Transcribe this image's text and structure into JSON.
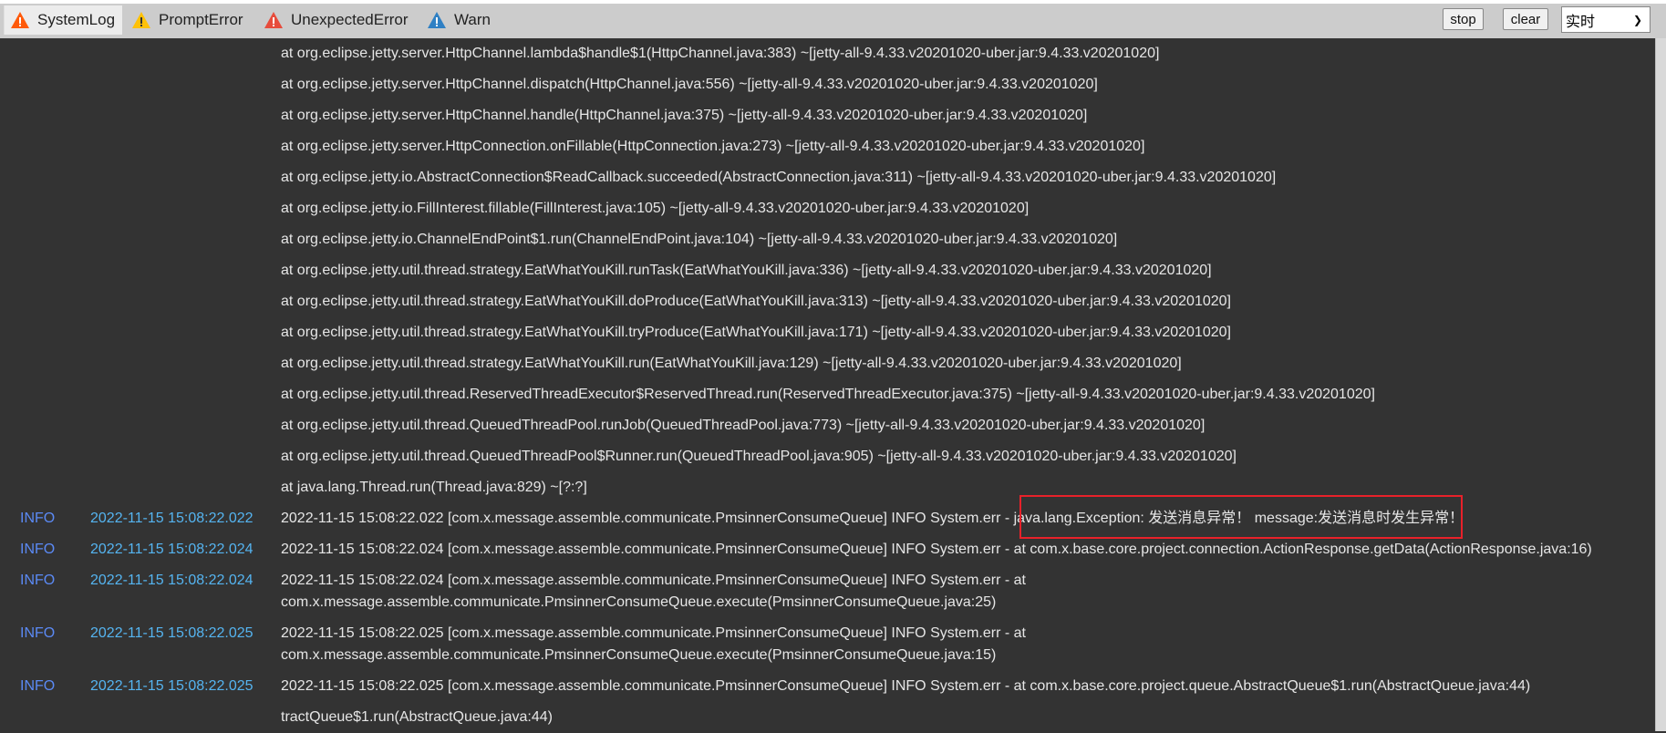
{
  "tabs": [
    {
      "label": "SystemLog",
      "icon": "warning-orange-icon",
      "color": "#ff5a0a",
      "active": true
    },
    {
      "label": "PromptError",
      "icon": "warning-yellow-icon",
      "color": "#ffc107"
    },
    {
      "label": "UnexpectedError",
      "icon": "warning-red-icon",
      "color": "#e74c3c"
    },
    {
      "label": "Warn",
      "icon": "warning-blue-icon",
      "color": "#2f80c4"
    }
  ],
  "toolbar": {
    "stop_label": "stop",
    "clear_label": "clear",
    "mode_value": "实时"
  },
  "stack": [
    "at org.eclipse.jetty.server.HttpChannel.lambda$handle$1(HttpChannel.java:383) ~[jetty-all-9.4.33.v20201020-uber.jar:9.4.33.v20201020]",
    "at org.eclipse.jetty.server.HttpChannel.dispatch(HttpChannel.java:556) ~[jetty-all-9.4.33.v20201020-uber.jar:9.4.33.v20201020]",
    "at org.eclipse.jetty.server.HttpChannel.handle(HttpChannel.java:375) ~[jetty-all-9.4.33.v20201020-uber.jar:9.4.33.v20201020]",
    "at org.eclipse.jetty.server.HttpConnection.onFillable(HttpConnection.java:273) ~[jetty-all-9.4.33.v20201020-uber.jar:9.4.33.v20201020]",
    "at org.eclipse.jetty.io.AbstractConnection$ReadCallback.succeeded(AbstractConnection.java:311) ~[jetty-all-9.4.33.v20201020-uber.jar:9.4.33.v20201020]",
    "at org.eclipse.jetty.io.FillInterest.fillable(FillInterest.java:105) ~[jetty-all-9.4.33.v20201020-uber.jar:9.4.33.v20201020]",
    "at org.eclipse.jetty.io.ChannelEndPoint$1.run(ChannelEndPoint.java:104) ~[jetty-all-9.4.33.v20201020-uber.jar:9.4.33.v20201020]",
    "at org.eclipse.jetty.util.thread.strategy.EatWhatYouKill.runTask(EatWhatYouKill.java:336) ~[jetty-all-9.4.33.v20201020-uber.jar:9.4.33.v20201020]",
    "at org.eclipse.jetty.util.thread.strategy.EatWhatYouKill.doProduce(EatWhatYouKill.java:313) ~[jetty-all-9.4.33.v20201020-uber.jar:9.4.33.v20201020]",
    "at org.eclipse.jetty.util.thread.strategy.EatWhatYouKill.tryProduce(EatWhatYouKill.java:171) ~[jetty-all-9.4.33.v20201020-uber.jar:9.4.33.v20201020]",
    "at org.eclipse.jetty.util.thread.strategy.EatWhatYouKill.run(EatWhatYouKill.java:129) ~[jetty-all-9.4.33.v20201020-uber.jar:9.4.33.v20201020]",
    "at org.eclipse.jetty.util.thread.ReservedThreadExecutor$ReservedThread.run(ReservedThreadExecutor.java:375) ~[jetty-all-9.4.33.v20201020-uber.jar:9.4.33.v20201020]",
    "at org.eclipse.jetty.util.thread.QueuedThreadPool.runJob(QueuedThreadPool.java:773) ~[jetty-all-9.4.33.v20201020-uber.jar:9.4.33.v20201020]",
    "at org.eclipse.jetty.util.thread.QueuedThreadPool$Runner.run(QueuedThreadPool.java:905) ~[jetty-all-9.4.33.v20201020-uber.jar:9.4.33.v20201020]",
    "at java.lang.Thread.run(Thread.java:829) ~[?:?]"
  ],
  "entries": [
    {
      "level": "INFO",
      "time": "2022-11-15 15:08:22.022",
      "message": "2022-11-15 15:08:22.022 [com.x.message.assemble.communicate.PmsinnerConsumeQueue] INFO System.err - java.lang.Exception: 发送消息异常！ message:发送消息时发生异常！",
      "highlighted_text": "java.lang.Exception: 发送消息异常！ message:发送消息时发生异常！"
    },
    {
      "level": "INFO",
      "time": "2022-11-15 15:08:22.024",
      "message": "2022-11-15 15:08:22.024 [com.x.message.assemble.communicate.PmsinnerConsumeQueue] INFO System.err - at com.x.base.core.project.connection.ActionResponse.getData(ActionResponse.java:16)"
    },
    {
      "level": "INFO",
      "time": "2022-11-15 15:08:22.024",
      "message": "2022-11-15 15:08:22.024 [com.x.message.assemble.communicate.PmsinnerConsumeQueue] INFO System.err - at com.x.message.assemble.communicate.PmsinnerConsumeQueue.execute(PmsinnerConsumeQueue.java:25)"
    },
    {
      "level": "INFO",
      "time": "2022-11-15 15:08:22.025",
      "message": "2022-11-15 15:08:22.025 [com.x.message.assemble.communicate.PmsinnerConsumeQueue] INFO System.err - at com.x.message.assemble.communicate.PmsinnerConsumeQueue.execute(PmsinnerConsumeQueue.java:15)"
    },
    {
      "level": "INFO",
      "time": "2022-11-15 15:08:22.025",
      "message": "2022-11-15 15:08:22.025 [com.x.message.assemble.communicate.PmsinnerConsumeQueue] INFO System.err - at com.x.base.core.project.queue.AbstractQueue$1.run(AbstractQueue.java:44)"
    }
  ],
  "trailing": "tractQueue$1.run(AbstractQueue.java:44)"
}
